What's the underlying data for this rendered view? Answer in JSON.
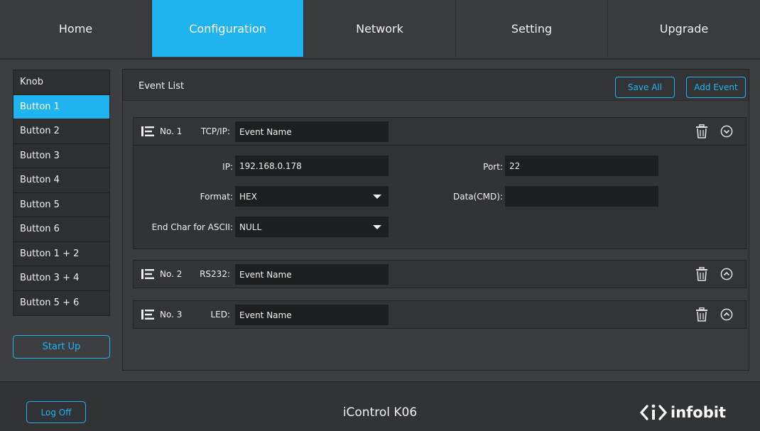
{
  "nav": {
    "tabs": [
      {
        "label": "Home"
      },
      {
        "label": "Configuration"
      },
      {
        "label": "Network"
      },
      {
        "label": "Setting"
      },
      {
        "label": "Upgrade"
      }
    ],
    "active": "Configuration"
  },
  "sidebar": {
    "items": [
      {
        "label": "Knob"
      },
      {
        "label": "Button 1"
      },
      {
        "label": "Button 2"
      },
      {
        "label": "Button 3"
      },
      {
        "label": "Button 4"
      },
      {
        "label": "Button 5"
      },
      {
        "label": "Button 6"
      },
      {
        "label": "Button 1 + 2"
      },
      {
        "label": "Button 3 + 4"
      },
      {
        "label": "Button 5 + 6"
      }
    ],
    "active": "Button 1",
    "startup_label": "Start Up"
  },
  "panel": {
    "title": "Event List",
    "save_all_label": "Save All",
    "add_event_label": "Add Event"
  },
  "events": [
    {
      "no": "No. 1",
      "type": "TCP/IP:",
      "name": "Event Name",
      "expanded": true,
      "ip_label": "IP:",
      "ip": "192.168.0.178",
      "port_label": "Port:",
      "port": "22",
      "format_label": "Format:",
      "format": "HEX",
      "data_label": "Data(CMD):",
      "data": "",
      "endchar_label": "End Char for ASCII:",
      "endchar": "NULL"
    },
    {
      "no": "No. 2",
      "type": "RS232:",
      "name": "Event Name",
      "expanded": false
    },
    {
      "no": "No. 3",
      "type": "LED:",
      "name": "Event Name",
      "expanded": false
    }
  ],
  "footer": {
    "logoff_label": "Log Off",
    "device_name": "iControl K06",
    "brand": "infobit"
  },
  "colors": {
    "accent": "#1fb4f0",
    "background": "#3b3c3f",
    "input_bg": "#1e1f21"
  },
  "icons": {
    "drag_handle": "list-drag-icon",
    "delete": "trash-icon",
    "collapse": "chevron-down-circle-icon",
    "expand": "chevron-up-circle-icon"
  }
}
